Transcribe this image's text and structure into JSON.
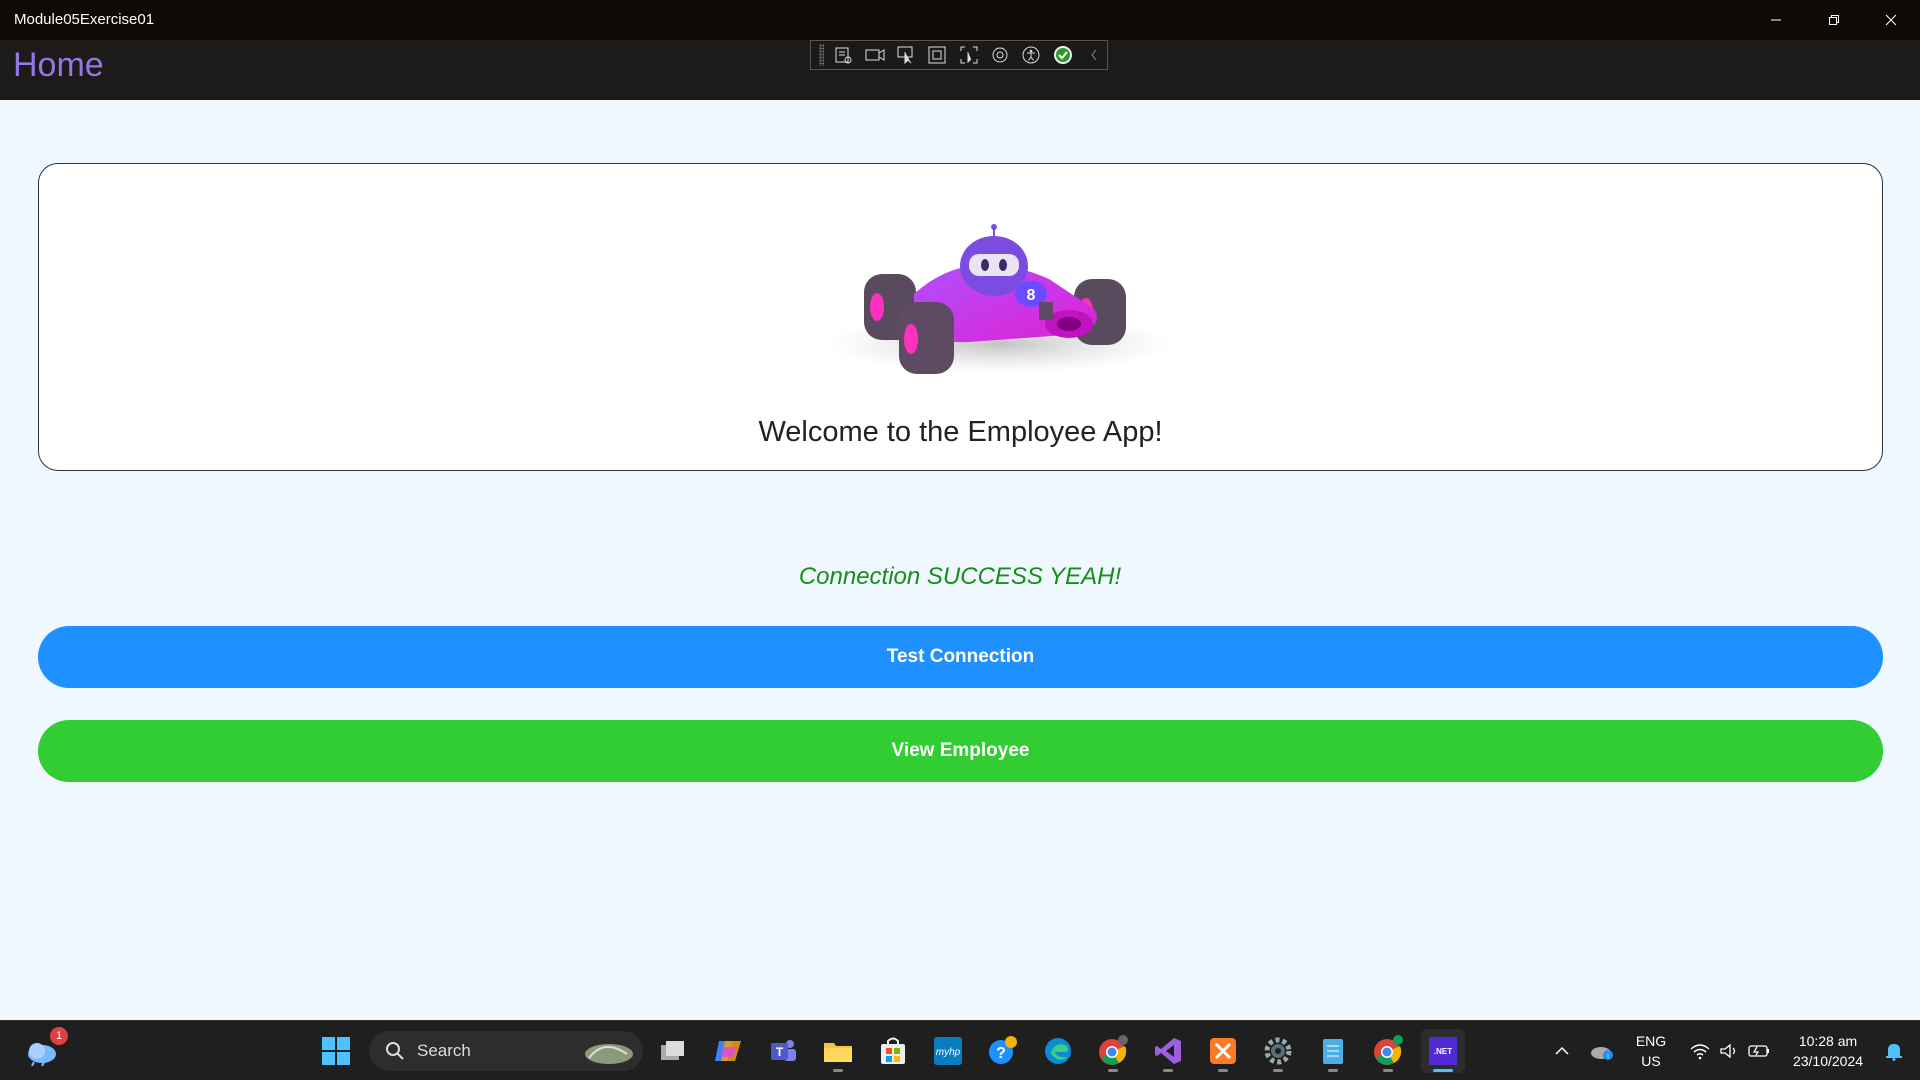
{
  "window": {
    "title": "Module05Exercise01"
  },
  "navbar": {
    "title": "Home"
  },
  "card": {
    "welcome_text": "Welcome to the Employee App!",
    "image": "dotnet-bot-race-car"
  },
  "status": {
    "message": "Connection SUCCESS YEAH!"
  },
  "buttons": {
    "test_connection": "Test Connection",
    "view_employee": "View Employee"
  },
  "taskbar": {
    "search_label": "Search",
    "weather_badge": "1",
    "language_line1": "ENG",
    "language_line2": "US",
    "time": "10:28 am",
    "date": "23/10/2024",
    "dotnet_label": ".NET"
  },
  "colors": {
    "nav_title": "#9277e6",
    "test_button": "#1e90ff",
    "view_button": "#32cd32",
    "status_text": "#168f16"
  }
}
